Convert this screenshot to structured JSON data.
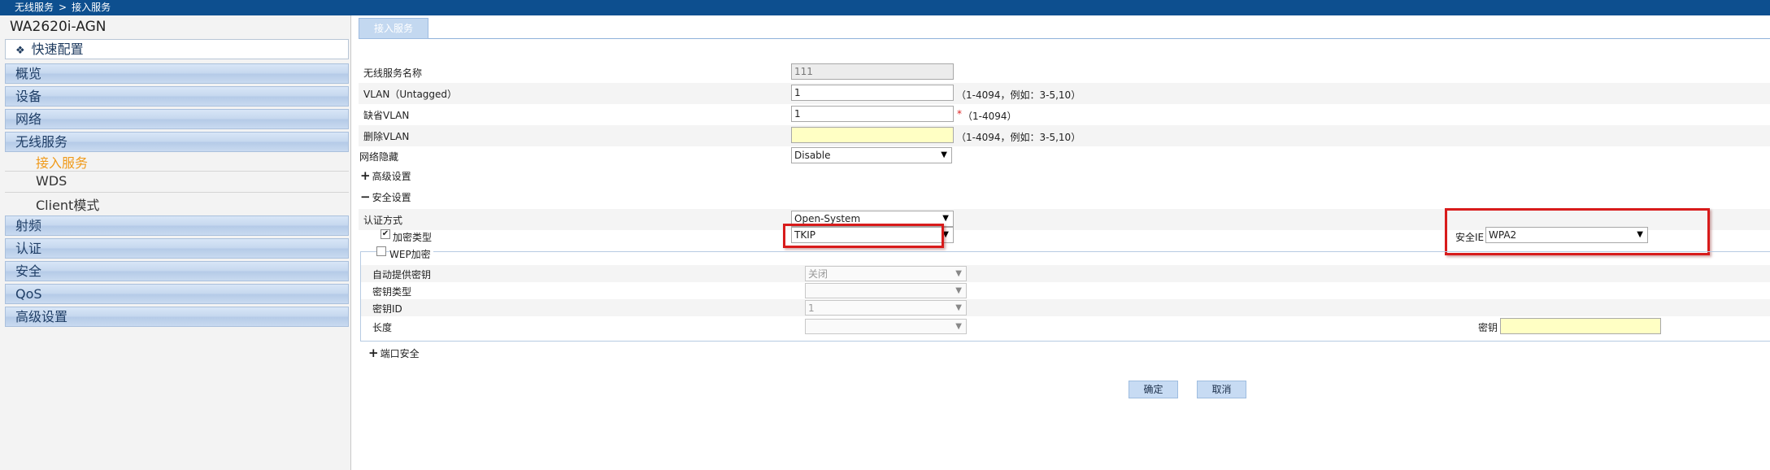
{
  "breadcrumb": {
    "parent": "无线服务",
    "separator": ">",
    "current": "接入服务"
  },
  "sidebar": {
    "device_name": "WA2620i-AGN",
    "quick_config": "快速配置",
    "items": [
      {
        "label": "概览"
      },
      {
        "label": "设备"
      },
      {
        "label": "网络"
      },
      {
        "label": "无线服务"
      }
    ],
    "sub_items": [
      {
        "label": "接入服务",
        "active": true
      },
      {
        "label": "WDS"
      },
      {
        "label": "Client模式"
      }
    ],
    "items_after": [
      {
        "label": "射频"
      },
      {
        "label": "认证"
      },
      {
        "label": "安全"
      },
      {
        "label": "QoS"
      },
      {
        "label": "高级设置"
      }
    ]
  },
  "main": {
    "tab_label": "接入服务",
    "form": {
      "service_name": {
        "label": "无线服务名称",
        "value": "111"
      },
      "vlan_untagged": {
        "label": "VLAN（Untagged）",
        "value": "1",
        "hint": "（1-4094，例如：3-5,10）"
      },
      "default_vlan": {
        "label": "缺省VLAN",
        "value": "1",
        "required_mark": "*",
        "hint": "（1-4094）"
      },
      "delete_vlan": {
        "label": "删除VLAN",
        "value": "",
        "hint": "（1-4094，例如：3-5,10）"
      },
      "network_hide": {
        "label": "网络隐藏",
        "value": "Disable"
      },
      "advanced_toggle": {
        "symbol": "+",
        "label": "高级设置"
      },
      "security_toggle": {
        "symbol": "−",
        "label": "安全设置"
      },
      "auth_mode": {
        "label": "认证方式",
        "value": "Open-System"
      },
      "cipher": {
        "label": "加密类型",
        "checked": true,
        "value": "TKIP"
      },
      "security_ie": {
        "label": "安全IE",
        "value": "WPA2"
      },
      "wep": {
        "label": "WEP加密",
        "checked": false,
        "auto_key": {
          "label": "自动提供密钥",
          "value": "关闭"
        },
        "key_type": {
          "label": "密钥类型",
          "value": ""
        },
        "key_id": {
          "label": "密钥ID",
          "value": "1"
        },
        "length": {
          "label": "长度",
          "value": ""
        },
        "key": {
          "label": "密钥",
          "value": ""
        }
      },
      "port_security_toggle": {
        "symbol": "+",
        "label": "端口安全"
      }
    },
    "buttons": {
      "ok": "确定",
      "cancel": "取消"
    }
  },
  "colors": {
    "topbar": "#0d4f8f",
    "nav_gradient": "#c5d7ee",
    "active_subitem": "#f09a1a",
    "highlight_box": "#d81b1b",
    "input_yellow": "#ffffc4"
  }
}
